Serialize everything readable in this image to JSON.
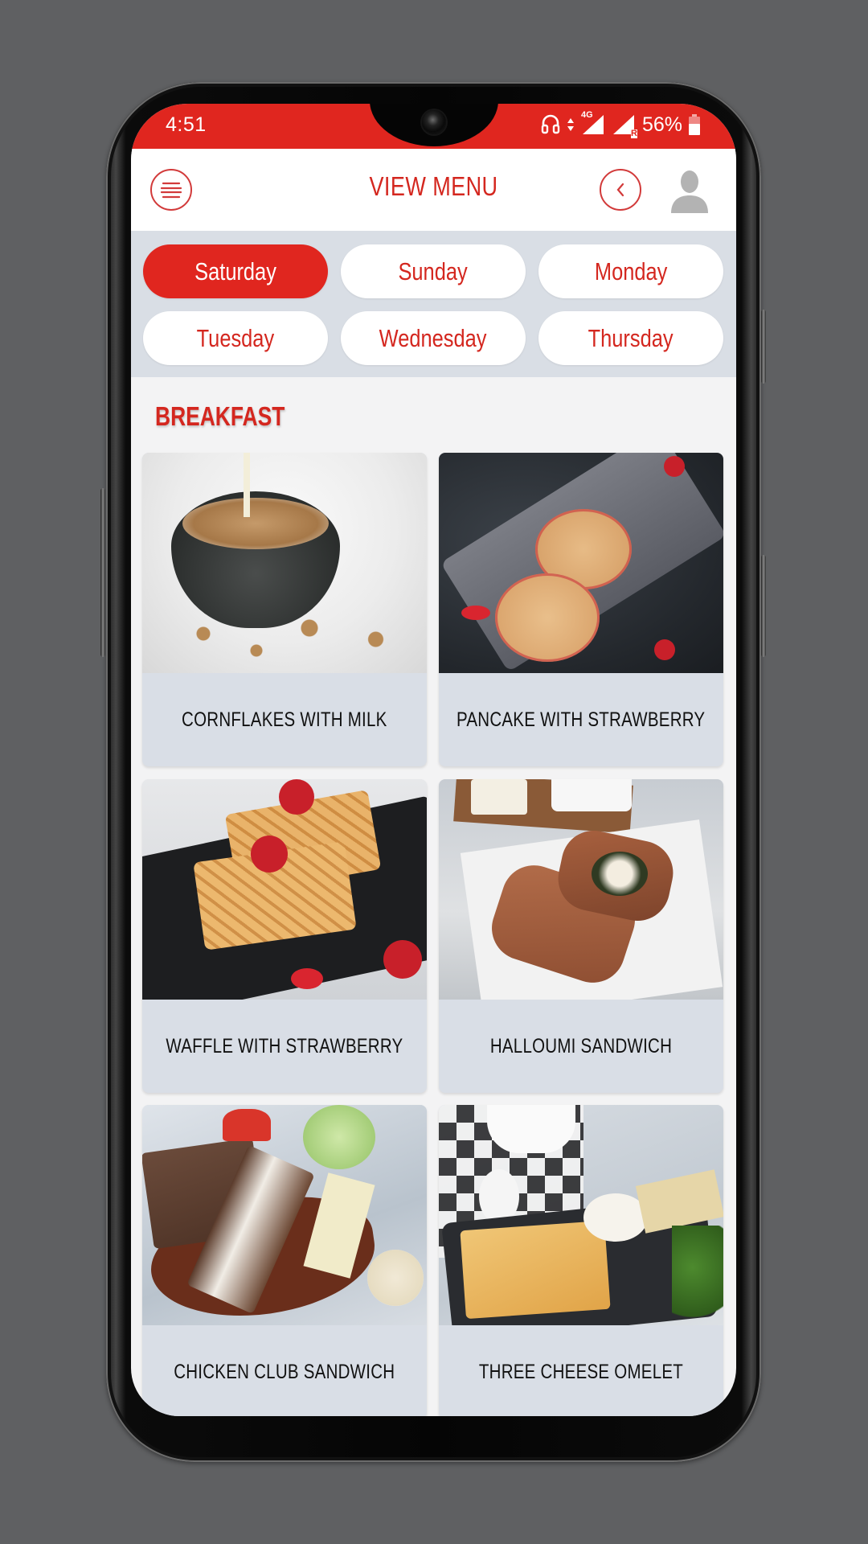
{
  "status_bar": {
    "time": "4:51",
    "network_label": "4G",
    "roaming_label": "R",
    "battery": "56%",
    "icons": [
      "headphones-icon",
      "data-arrows-icon",
      "signal-4g-icon",
      "signal-roaming-icon",
      "battery-icon"
    ]
  },
  "header": {
    "title": "VIEW MENU",
    "menu_icon": "hamburger-menu-icon",
    "back_icon": "chevron-left-icon",
    "profile_icon": "user-avatar-icon"
  },
  "days": [
    {
      "label": "Saturday",
      "active": true
    },
    {
      "label": "Sunday",
      "active": false
    },
    {
      "label": "Monday",
      "active": false
    },
    {
      "label": "Tuesday",
      "active": false
    },
    {
      "label": "Wednesday",
      "active": false
    },
    {
      "label": "Thursday",
      "active": false
    }
  ],
  "section": {
    "title": "BREAKFAST",
    "items": [
      {
        "name": "CORNFLAKES WITH MILK",
        "image": "cornflakes-photo"
      },
      {
        "name": "PANCAKE WITH STRAWBERRY",
        "image": "pancake-photo"
      },
      {
        "name": "WAFFLE WITH STRAWBERRY",
        "image": "waffle-photo"
      },
      {
        "name": "HALLOUMI SANDWICH",
        "image": "halloumi-photo"
      },
      {
        "name": "CHICKEN CLUB SANDWICH",
        "image": "club-sandwich-photo"
      },
      {
        "name": "THREE CHEESE OMELET",
        "image": "omelet-photo"
      }
    ]
  },
  "colors": {
    "accent": "#e0261f",
    "title_red": "#d4271f",
    "day_panel_bg": "#d9dee5",
    "card_bg": "#d9dee6",
    "page_bg": "#f3f3f4",
    "backdrop": "#5f6062"
  }
}
